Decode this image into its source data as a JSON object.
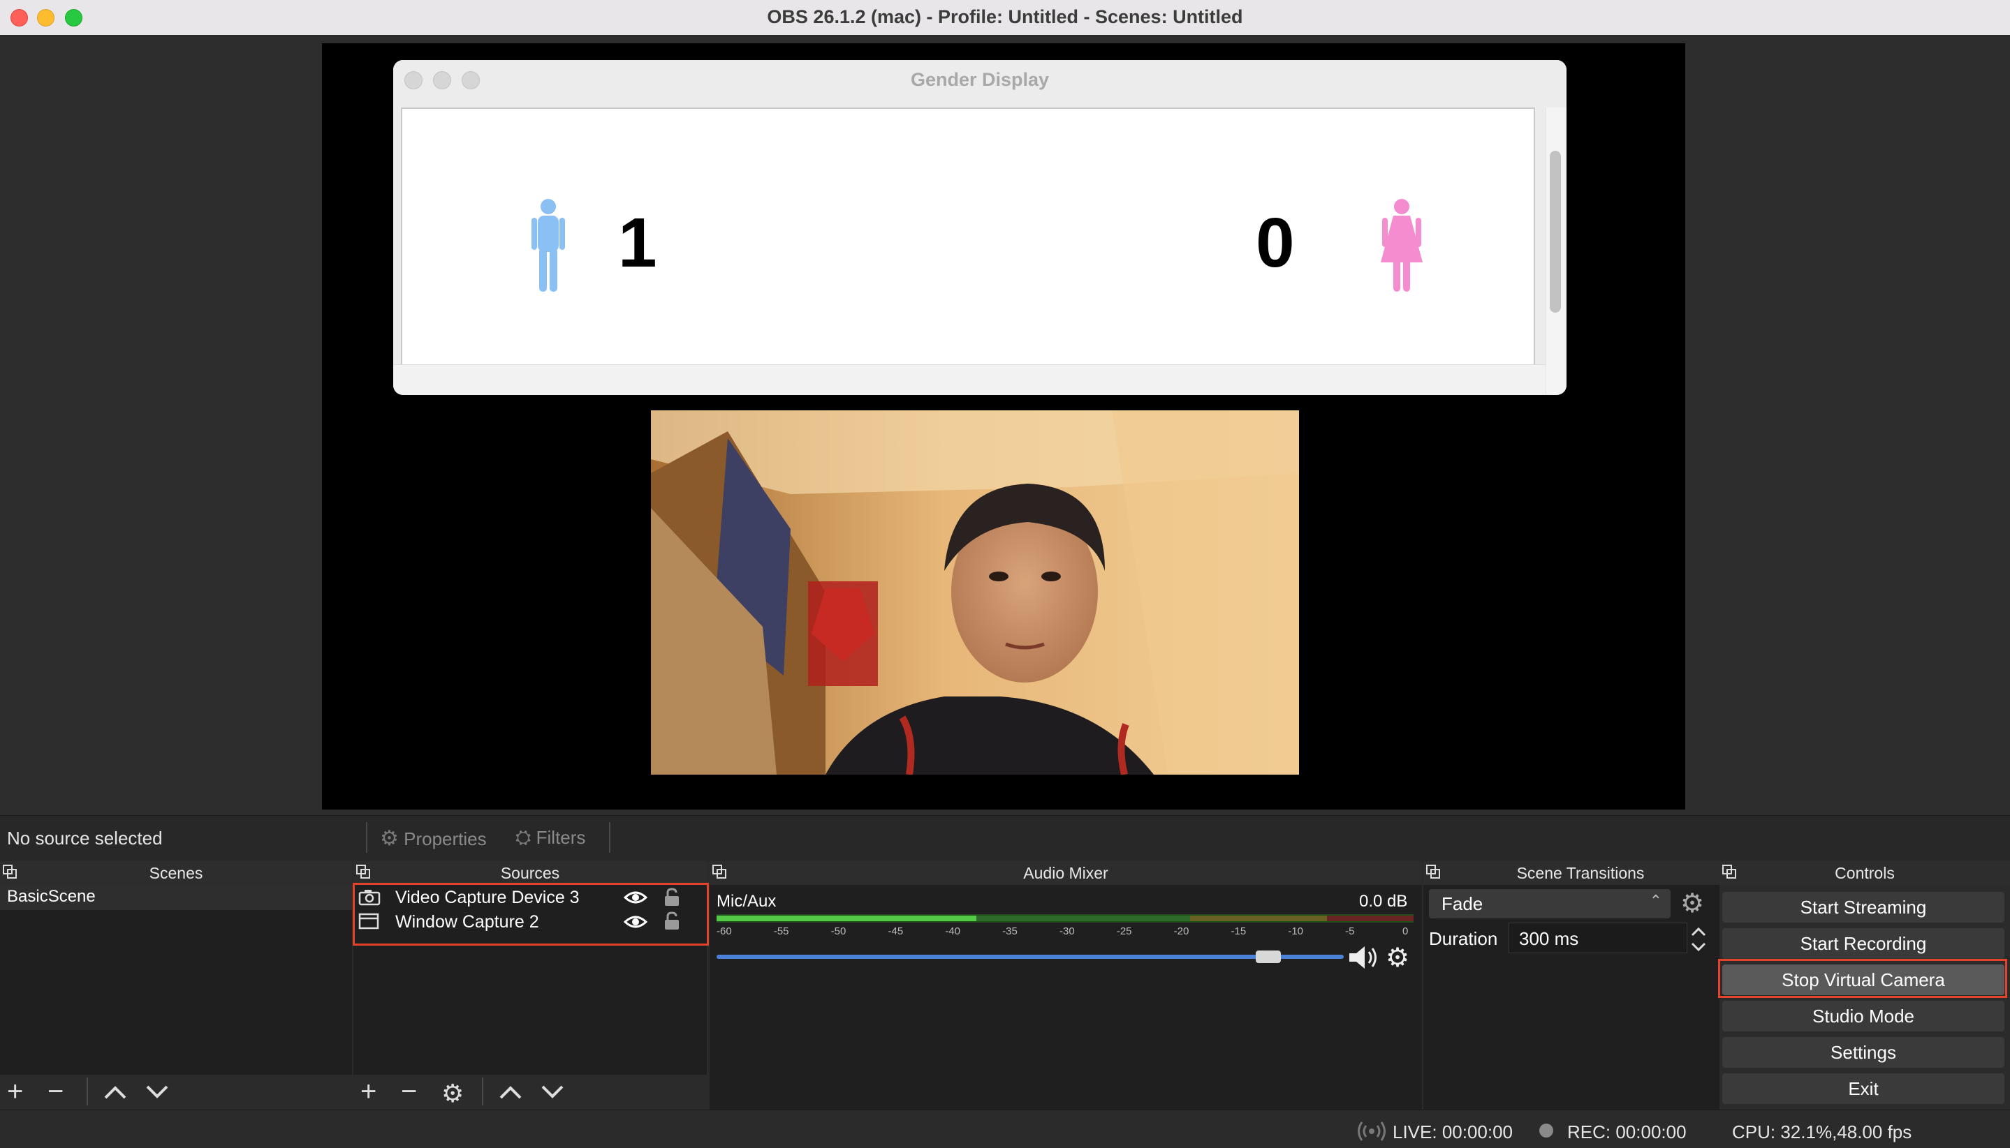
{
  "window": {
    "title": "OBS 26.1.2 (mac) - Profile: Untitled - Scenes: Untitled"
  },
  "preview": {
    "gender_window": {
      "title": "Gender Display",
      "male_count": "1",
      "female_count": "0",
      "male_color": "#8ac0f4",
      "female_color": "#f58ccf"
    }
  },
  "source_toolbar": {
    "status": "No source selected",
    "properties_label": "Properties",
    "filters_label": "Filters"
  },
  "scenes": {
    "title": "Scenes",
    "items": [
      "BasicScene"
    ]
  },
  "sources": {
    "title": "Sources",
    "items": [
      {
        "label": "Video Capture Device 3",
        "icon": "camera-icon"
      },
      {
        "label": "Window Capture 2",
        "icon": "window-icon"
      }
    ]
  },
  "audio_mixer": {
    "title": "Audio Mixer",
    "channel": "Mic/Aux",
    "level": "0.0 dB",
    "ticks": [
      "-60",
      "-55",
      "-50",
      "-45",
      "-40",
      "-35",
      "-30",
      "-25",
      "-20",
      "-15",
      "-10",
      "-5",
      "0"
    ],
    "volume_fraction": 0.9
  },
  "scene_transitions": {
    "title": "Scene Transitions",
    "selected": "Fade",
    "duration_label": "Duration",
    "duration_value": "300 ms"
  },
  "controls": {
    "title": "Controls",
    "start_streaming": "Start Streaming",
    "start_recording": "Start Recording",
    "stop_virtual_camera": "Stop Virtual Camera",
    "studio_mode": "Studio Mode",
    "settings": "Settings",
    "exit": "Exit"
  },
  "status_bar": {
    "live": "LIVE: 00:00:00",
    "rec": "REC: 00:00:00",
    "cpu": "CPU: 32.1%,48.00 fps"
  },
  "colors": {
    "highlight": "#e4432b",
    "meter_green": "#3fae33",
    "volume_blue": "#4b82d8"
  }
}
